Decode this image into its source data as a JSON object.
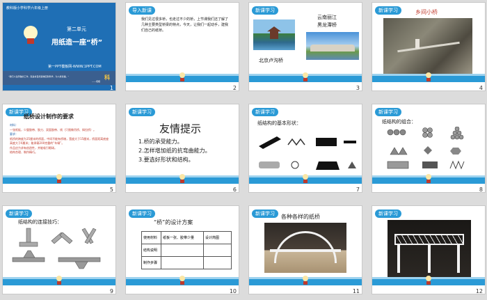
{
  "slides": [
    {
      "num": "1",
      "school": "教科版小学科学六年级上册",
      "unit": "第二单元",
      "title": "用纸造一座“桥”",
      "site": "第一PPT模板网-WWW.1PPT.COM",
      "quote": "“我们人生所做的工作，就是将自然造物回到科学，为人类谋福。”",
      "sign": "——培根",
      "logo": "科"
    },
    {
      "num": "2",
      "badge": "导入新课",
      "text": "我们见过很多桥，也走过不少的桥，上节课我们还了解了几种主要类型桥梁的特点，今天，让我们一起动手，建我们自己的纸桥。"
    },
    {
      "num": "3",
      "badge": "新课学习",
      "cap1": "云南丽江",
      "cap2": "黑龙潭桥",
      "cap3": "北京卢沟桥"
    },
    {
      "num": "4",
      "badge": "新课学习",
      "cap": "乡间小桥"
    },
    {
      "num": "5",
      "badge": "新课学习",
      "title": "纸桥设计制作的要求",
      "lines": [
        "材料：",
        "一张纸板，少量胶带、胶刀、双面胶带、线（只限做吊桥、斜拉桥）。",
        "要求：",
        "纸桥的跨度为35厘米的桥面，中间不能有桥墩，宽度大于15厘米，桥面距离底座高度大于6厘米；能承载200克重的“车辆”。",
        "作品应力求有创造性，并能吸引眼球。",
        "结构合理、制作精巧。"
      ]
    },
    {
      "num": "6",
      "badge": "新课学习",
      "title": "友情提示",
      "lines": [
        "1.桥的承受能力。",
        "2.怎样增加纸的抗弯曲能力。",
        "3.要选好形状和结构。"
      ]
    },
    {
      "num": "7",
      "badge": "新课学习",
      "title": "纸结构的基本形状："
    },
    {
      "num": "8",
      "badge": "新课学习",
      "title": "纸结构的组合："
    },
    {
      "num": "9",
      "badge": "新课学习",
      "title": "纸结构的连接技巧："
    },
    {
      "num": "10",
      "badge": "新课学习",
      "title": "“桥”的设计方案",
      "table": [
        [
          "使用材料",
          "纸板一张、胶带少量",
          "设计简图"
        ],
        [
          "结构说明",
          "",
          ""
        ],
        [
          "制作步骤",
          "",
          ""
        ]
      ]
    },
    {
      "num": "11",
      "badge": "新课学习",
      "title": "各种各样的纸桥"
    },
    {
      "num": "12",
      "badge": "新课学习"
    }
  ],
  "colors": {
    "accent": "#2a9ad6",
    "title_blue": "#1f5fa8",
    "red": "#c0392b"
  }
}
